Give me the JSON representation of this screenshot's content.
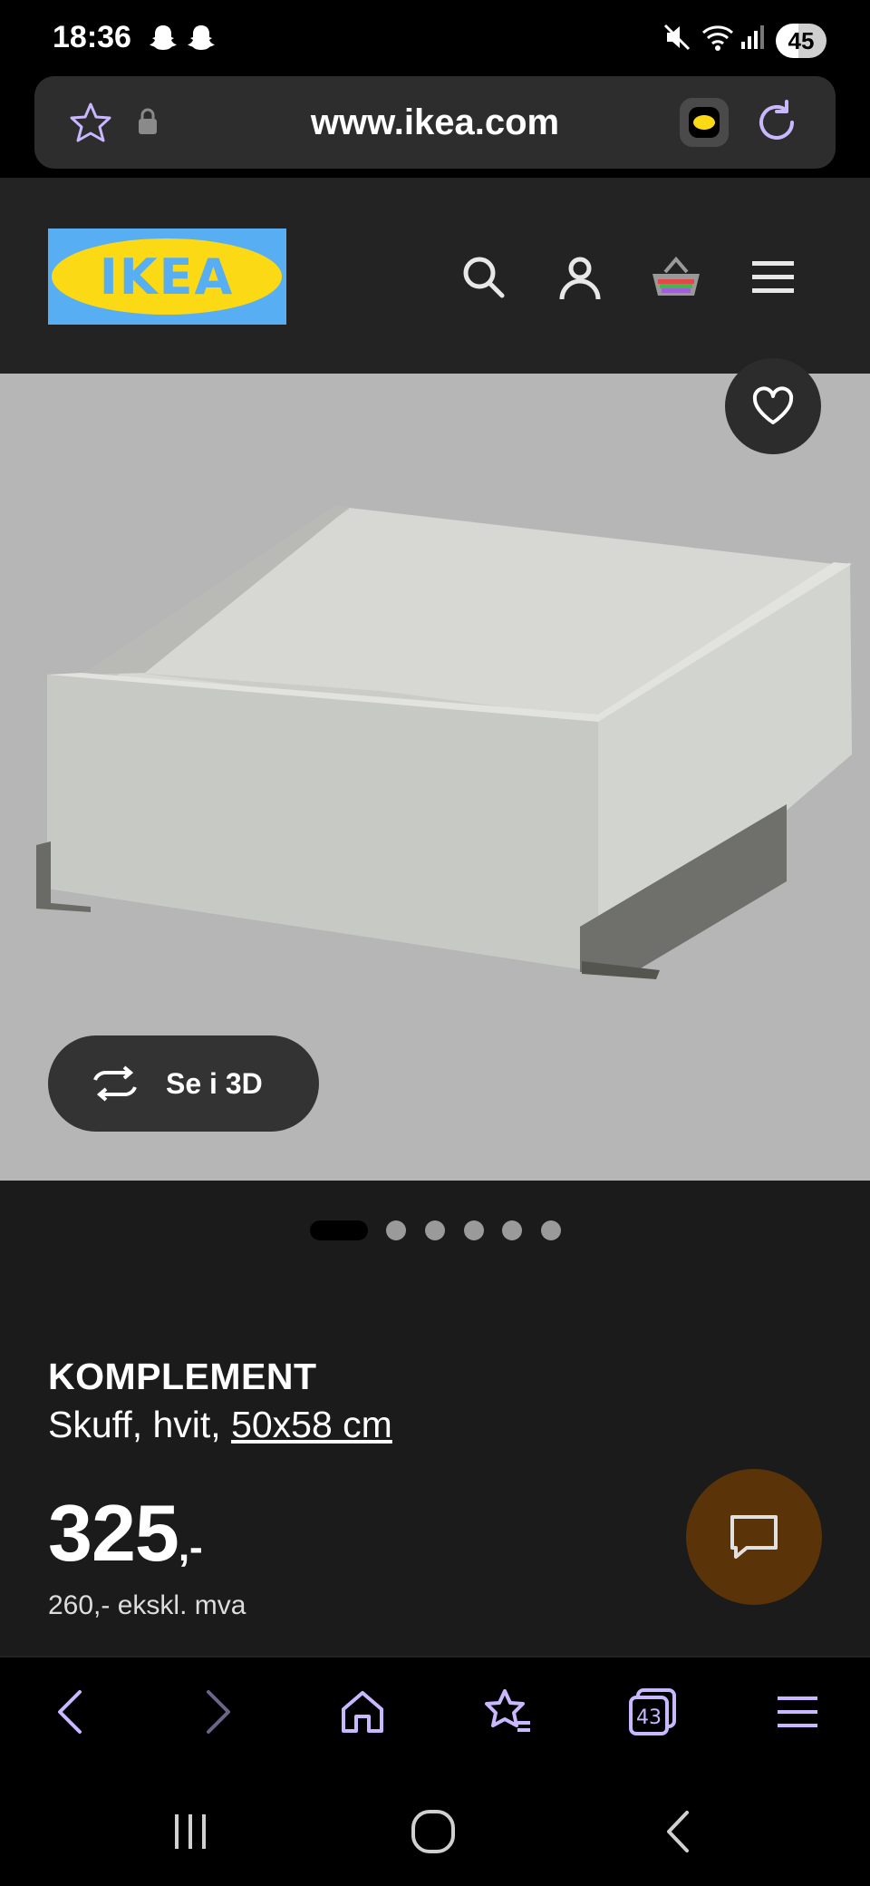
{
  "status_bar": {
    "time": "18:36",
    "notification_icons": [
      "snapchat-icon",
      "snapchat-icon"
    ],
    "indicator_icons": [
      "mute-icon",
      "wifi-icon",
      "signal-icon"
    ],
    "battery": "45"
  },
  "browser": {
    "url": "www.ikea.com",
    "tab_count": "43"
  },
  "header": {
    "logo_text": "IKEA",
    "icons": [
      "search-icon",
      "account-icon",
      "basket-icon",
      "menu-icon"
    ]
  },
  "gallery": {
    "view_3d_label": "Se i 3D",
    "dot_count": 6,
    "active_dot": 0
  },
  "product": {
    "name": "KOMPLEMENT",
    "description_prefix": "Skuff, hvit, ",
    "size": "50x58 cm",
    "price": "325",
    "price_suffix": ",-",
    "price_ex_vat": "260,- ekskl. mva"
  },
  "colors": {
    "accent_nav": "#c9b8ff",
    "chat_button": "#5a3308",
    "ikea_yellow": "#fbd914",
    "ikea_blue": "#58aef2"
  }
}
